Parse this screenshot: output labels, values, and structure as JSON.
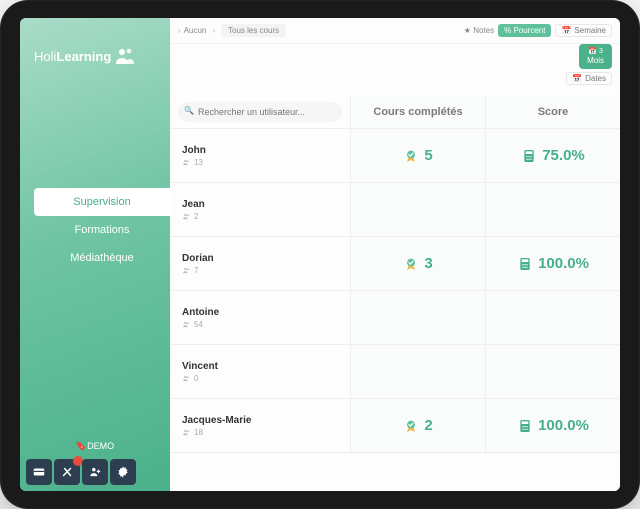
{
  "brand": {
    "prefix": "Holi",
    "bold": "Learning"
  },
  "nav": {
    "items": [
      {
        "label": "Supervision",
        "active": true
      },
      {
        "label": "Formations",
        "active": false
      },
      {
        "label": "Médiathèque",
        "active": false
      }
    ],
    "demo": "DEMO"
  },
  "topbar": {
    "crumb_back": "Aucun",
    "filter_all": "Tous les cours",
    "notes": "Notes",
    "percent": "% Pourcent",
    "semaine": "Semaine",
    "mois_number": "3",
    "mois_label": "Mois",
    "dates": "Dates"
  },
  "search": {
    "placeholder": "Rechercher un utilisateur..."
  },
  "columns": {
    "completed": "Cours complétés",
    "score": "Score"
  },
  "rows": [
    {
      "name": "John",
      "count": "13",
      "completed": "5",
      "score": "75.0%"
    },
    {
      "name": "Jean",
      "count": "2",
      "completed": "",
      "score": ""
    },
    {
      "name": "Dorian",
      "count": "7",
      "completed": "3",
      "score": "100.0%"
    },
    {
      "name": "Antoine",
      "count": "54",
      "completed": "",
      "score": ""
    },
    {
      "name": "Vincent",
      "count": "0",
      "completed": "",
      "score": ""
    },
    {
      "name": "Jacques-Marie",
      "count": "18",
      "completed": "2",
      "score": "100.0%"
    }
  ],
  "colors": {
    "accent": "#45b08a"
  }
}
